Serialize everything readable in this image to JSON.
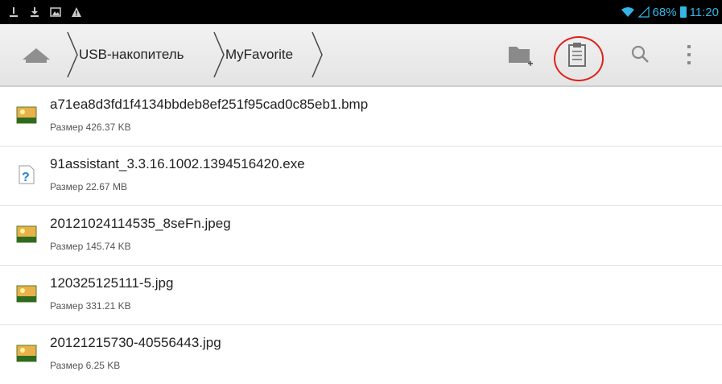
{
  "status_bar": {
    "battery_percent": "68%",
    "time": "11:20",
    "icons": [
      "usb-debug-icon",
      "download-icon",
      "image-icon",
      "warning-icon",
      "wifi-icon",
      "signal-icon",
      "battery-icon"
    ]
  },
  "toolbar": {
    "breadcrumb": [
      "USB-накопитель",
      "MyFavorite"
    ],
    "actions": [
      "new-folder-icon",
      "paste-clipboard-icon",
      "search-icon",
      "overflow-menu-icon"
    ]
  },
  "files": [
    {
      "name": "a71ea8d3fd1f4134bbdeb8ef251f95cad0c85eb1.bmp",
      "size": "Размер 426.37 KB",
      "icon": "image-file-icon"
    },
    {
      "name": "91assistant_3.3.16.1002.1394516420.exe",
      "size": "Размер 22.67 MB",
      "icon": "unknown-file-icon"
    },
    {
      "name": "20121024114535_8seFn.jpeg",
      "size": "Размер 145.74 KB",
      "icon": "image-file-icon"
    },
    {
      "name": "120325125111-5.jpg",
      "size": "Размер 331.21 KB",
      "icon": "image-file-icon"
    },
    {
      "name": "20121215730-40556443.jpg",
      "size": "Размер 6.25 KB",
      "icon": "image-file-icon"
    }
  ],
  "colors": {
    "accent": "#33b5e5",
    "highlight_circle": "#e0201b"
  }
}
